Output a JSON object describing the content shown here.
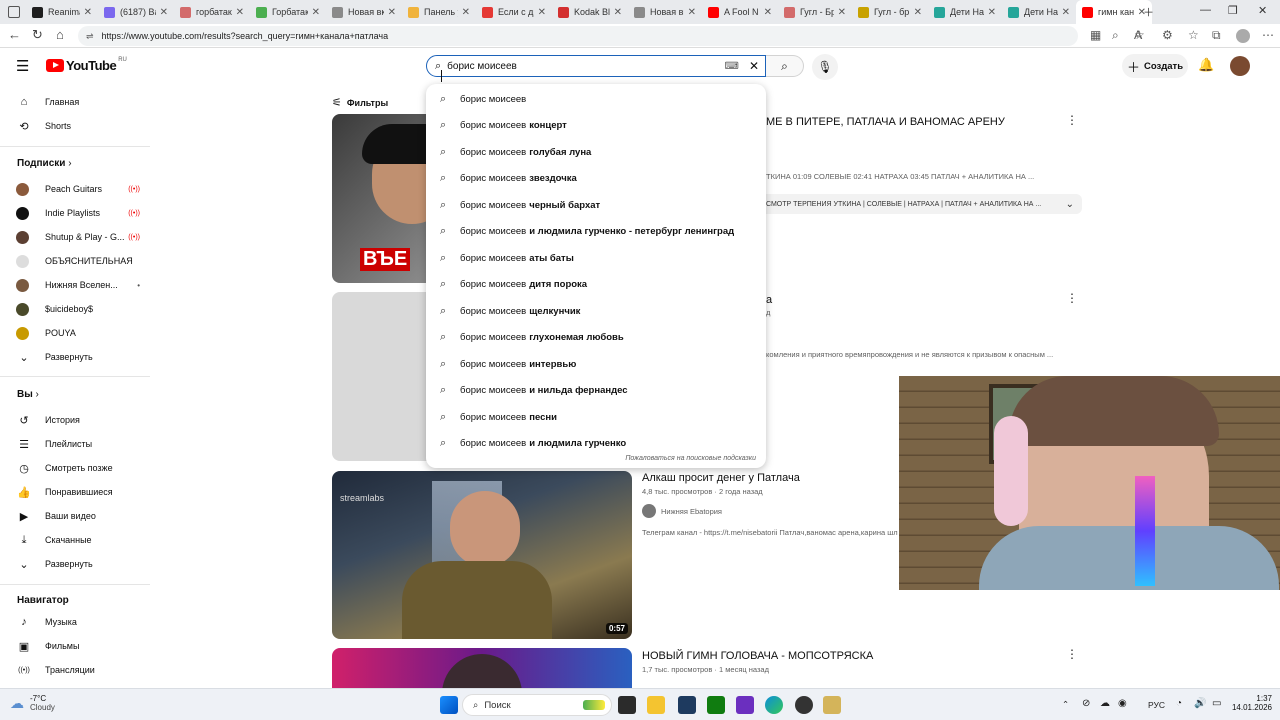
{
  "colors": {
    "youtube_red": "#ff0000",
    "focus_blue": "#1c62b9",
    "tab_bg": "#e8eaed"
  },
  "browser": {
    "tabs": [
      {
        "label": "Reanimat",
        "color": "#1f1f1f"
      },
      {
        "label": "(6187) Ва",
        "color": "#7b68ee"
      },
      {
        "label": "горбатак",
        "color": "#d36b6b"
      },
      {
        "label": "Горбатак",
        "color": "#4caf50"
      },
      {
        "label": "Новая вк",
        "color": "#8a8a8a"
      },
      {
        "label": "Панель у",
        "color": "#f0b33c"
      },
      {
        "label": "Если с др",
        "color": "#e53935"
      },
      {
        "label": "Kodak Bla",
        "color": "#d32f2f"
      },
      {
        "label": "Новая вк",
        "color": "#8a8a8a"
      },
      {
        "label": "A Fool N",
        "color": "#ff0000"
      },
      {
        "label": "Гугл - Бр",
        "color": "#d36b6b"
      },
      {
        "label": "Гугл - бр",
        "color": "#c8a200"
      },
      {
        "label": "Дети Нат",
        "color": "#26a69a"
      },
      {
        "label": "Дети Нат",
        "color": "#26a69a"
      },
      {
        "label": "гимн кан",
        "color": "#ff0000",
        "active": true
      }
    ],
    "url": "https://www.youtube.com/results?search_query=гимн+канала+патлача"
  },
  "youtube": {
    "logo": "YouTube",
    "region": "RU",
    "search_value": "борис моисеев",
    "create_label": "Создать",
    "filters_label": "Фильтры"
  },
  "suggestions": {
    "prefix": "борис моисеев",
    "items": [
      "",
      "концерт",
      "голубая луна",
      "звездочка",
      "черный бархат",
      "и людмила гурченко - петербург ленинград",
      "аты баты",
      "дитя порока",
      "щелкунчик",
      "глухонемая любовь",
      "интервью",
      "и нильда фернандес",
      "песни",
      "и людмила гурченко"
    ],
    "report": "Пожаловаться на поисковые подсказки"
  },
  "sidebar": {
    "main": [
      {
        "label": "Главная",
        "icon": "home-icon",
        "glyph": "⌂"
      },
      {
        "label": "Shorts",
        "icon": "shorts-icon",
        "glyph": "⟲"
      }
    ],
    "subs_header": "Подписки",
    "subs": [
      {
        "label": "Peach Guitars",
        "color": "#8b5a3c",
        "live": true
      },
      {
        "label": "Indie Playlists",
        "color": "#111111",
        "live": true
      },
      {
        "label": "Shutup & Play - G...",
        "color": "#5c4033",
        "live": true
      },
      {
        "label": "ОБЪЯСНИТЕЛЬНАЯ",
        "color": "#dddddd",
        "live": false
      },
      {
        "label": "Нижняя Вселен...",
        "color": "#7a5a40",
        "live": false,
        "dot": true
      },
      {
        "label": "$uicideboy$",
        "color": "#4a4a2a",
        "live": false
      },
      {
        "label": "POUYA",
        "color": "#c89a00",
        "live": false
      },
      {
        "label": "Развернуть",
        "icon": "chevron-down-icon",
        "live": false
      }
    ],
    "you_header": "Вы",
    "you": [
      {
        "label": "История",
        "glyph": "↺"
      },
      {
        "label": "Плейлисты",
        "glyph": "☰"
      },
      {
        "label": "Смотреть позже",
        "glyph": "◷"
      },
      {
        "label": "Понравившиеся",
        "glyph": "👍"
      },
      {
        "label": "Ваши видео",
        "glyph": "▶"
      },
      {
        "label": "Скачанные",
        "glyph": "⤓"
      },
      {
        "label": "Развернуть",
        "glyph": "⌄"
      }
    ],
    "nav_header": "Навигатор",
    "nav": [
      {
        "label": "Музыка",
        "glyph": "♪"
      },
      {
        "label": "Фильмы",
        "glyph": "▣"
      },
      {
        "label": "Трансляции",
        "glyph": "((•))"
      }
    ]
  },
  "videos": [
    {
      "title_visible": "МЕ В ПИТЕРЕ, ПАТЛАЧА И ВАНОМАС АРЕНУ",
      "desc": "ТКИНА 01:09 СОЛЕВЫЕ 02:41 НАТРАХА 03:45 ПАТЛАЧ + АНАЛИТИКА НА ...",
      "chapters": "СМОТР ТЕРПЕНИЯ УТКИНА | СОЛЕВЫЕ | НАТРАХА | ПАТЛАЧ + АНАЛИТИКА НА ...",
      "thumb_text": "ВЪЕ"
    },
    {
      "title_visible": "а",
      "channel_visible": "д",
      "desc": "комления и приятного времяпровождения и не являются к призывом к опасным ..."
    },
    {
      "title": "Алкаш просит денег у Патлача",
      "meta": "4,8 тыс. просмотров · 2 года назад",
      "channel": "Нижняя Еbatория",
      "desc": "Телеграм канал - https://t.me/nisebatorii Патлач,ваномас арена,карина шлак",
      "duration": "0:57",
      "watermark": "streamlabs"
    },
    {
      "title": "НОВЫЙ ГИМН ГОЛОВАЧА - МОПСОТРЯСКА",
      "meta": "1,7 тыс. просмотров · 1 месяц назад"
    }
  ],
  "taskbar": {
    "weather_temp": "-7°C",
    "weather_desc": "Cloudy",
    "search_label": "Поиск",
    "lang": "РУС",
    "time": "1:37",
    "date": "14.01.2026"
  }
}
